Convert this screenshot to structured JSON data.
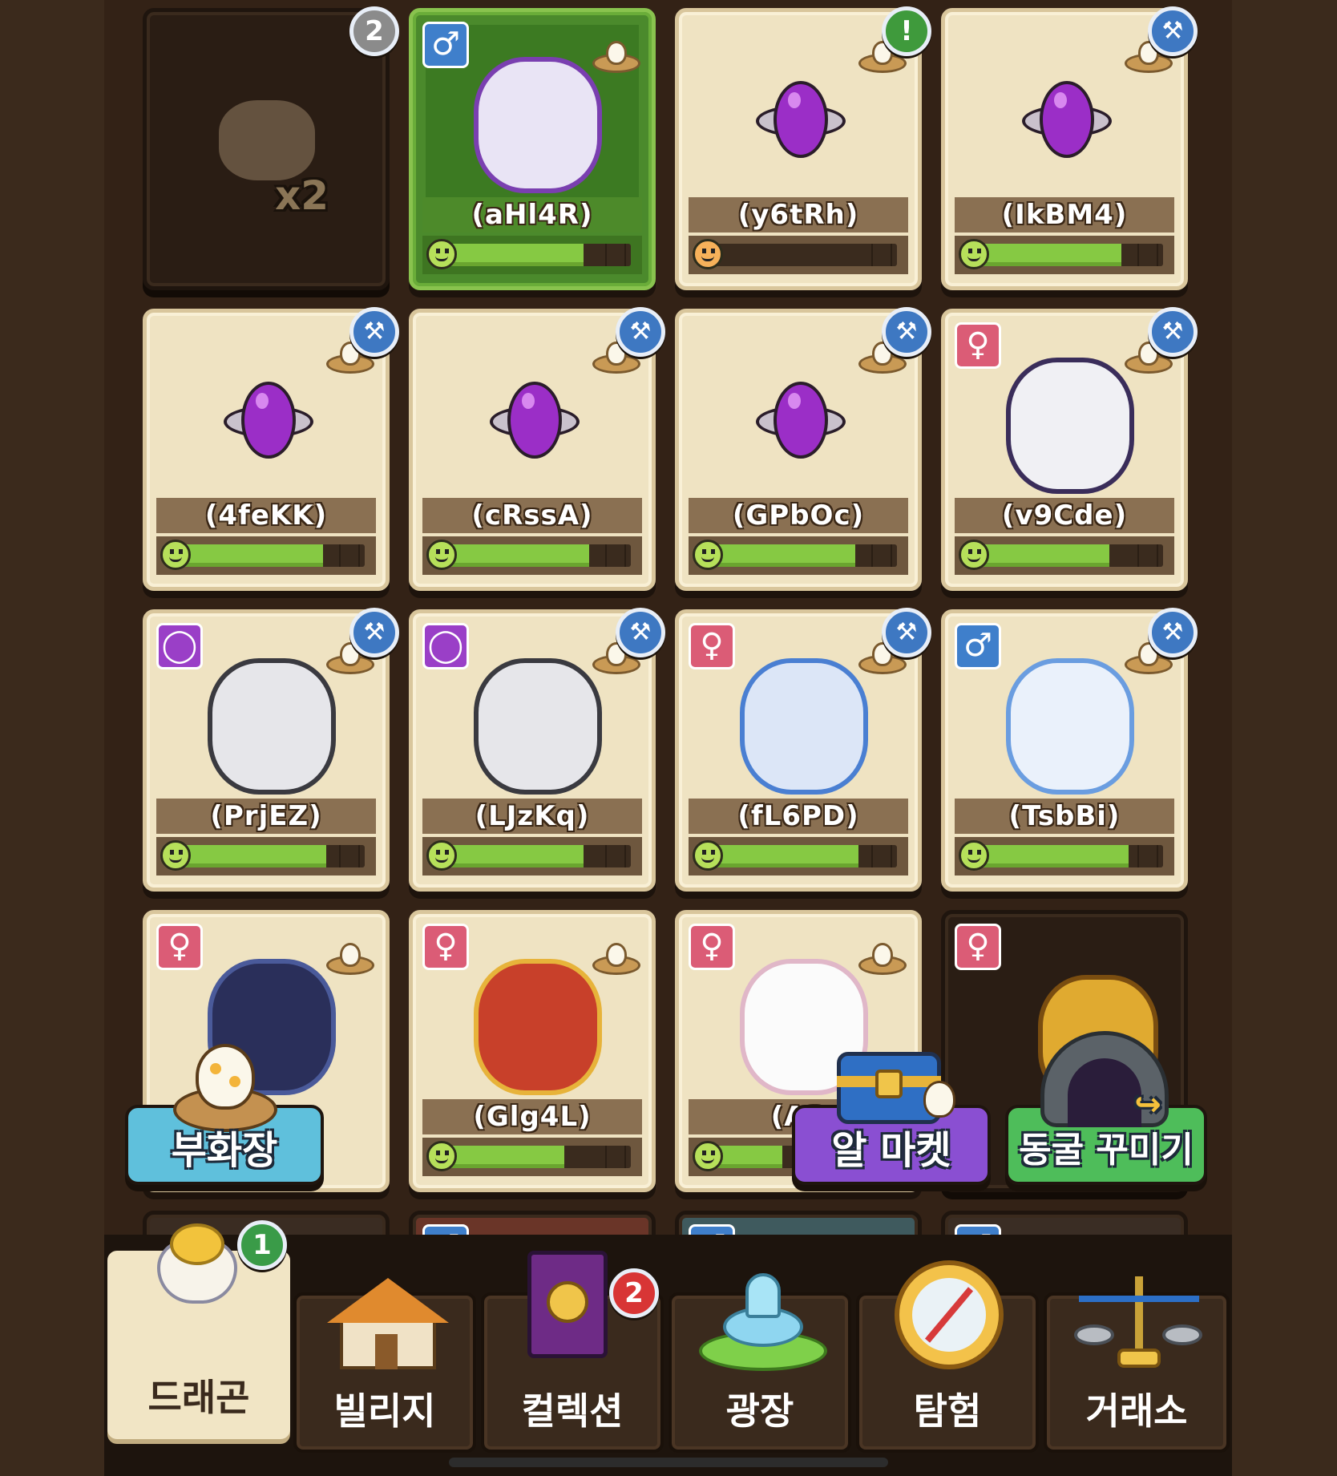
{
  "cards": [
    {
      "name": "",
      "badge": "2",
      "badge_type": "count",
      "dark": true,
      "multiplier": "x2"
    },
    {
      "name": "(aHl4R)",
      "gender": "♂",
      "gender_type": "m",
      "badge_type": "none",
      "selected": true,
      "health": 0.75,
      "nest": true
    },
    {
      "name": "(y6tRh)",
      "badge": "!",
      "badge_type": "alert",
      "health": 0.05,
      "health_color": "orange",
      "nest": true,
      "sprite": "egg"
    },
    {
      "name": "(IkBM4)",
      "badge": "⚒",
      "badge_type": "tool",
      "health": 0.78,
      "nest": true,
      "sprite": "egg"
    },
    {
      "name": "(4feKK)",
      "badge": "⚒",
      "badge_type": "tool",
      "health": 0.78,
      "nest": true,
      "sprite": "egg"
    },
    {
      "name": "(cRssA)",
      "badge": "⚒",
      "badge_type": "tool",
      "health": 0.78,
      "nest": true,
      "sprite": "egg"
    },
    {
      "name": "(GPbOc)",
      "badge": "⚒",
      "badge_type": "tool",
      "health": 0.78,
      "nest": true,
      "sprite": "egg"
    },
    {
      "name": "(v9Cde)",
      "gender": "♀",
      "gender_type": "f",
      "badge": "⚒",
      "badge_type": "tool",
      "health": 0.72,
      "nest": true
    },
    {
      "name": "(PrjEZ)",
      "gender": "◯",
      "gender_type": "n",
      "badge": "⚒",
      "badge_type": "tool",
      "health": 0.8,
      "nest": true
    },
    {
      "name": "(LJzKq)",
      "gender": "◯",
      "gender_type": "n",
      "badge": "⚒",
      "badge_type": "tool",
      "health": 0.75,
      "nest": true
    },
    {
      "name": "(fL6PD)",
      "gender": "♀",
      "gender_type": "f",
      "badge": "⚒",
      "badge_type": "tool",
      "health": 0.8,
      "nest": true
    },
    {
      "name": "(TsbBi)",
      "gender": "♂",
      "gender_type": "m",
      "badge": "⚒",
      "badge_type": "tool",
      "health": 0.82,
      "nest": true
    },
    {
      "name": "",
      "gender": "♀",
      "gender_type": "f",
      "badge_type": "none",
      "health": 0.0,
      "nest": true
    },
    {
      "name": "(Glg4L)",
      "gender": "♀",
      "gender_type": "f",
      "badge_type": "none",
      "health": 0.65,
      "nest": true
    },
    {
      "name": "(A3",
      "gender": "♀",
      "gender_type": "f",
      "badge_type": "none",
      "health": 0.4,
      "nest": true
    },
    {
      "name": "",
      "gender": "♀",
      "gender_type": "f",
      "badge_type": "none",
      "dark": true
    }
  ],
  "row5_genders": [
    "",
    "♂",
    "♂",
    "♂"
  ],
  "actions": {
    "hatchery": "부화장",
    "egg_market": "알 마켓",
    "cave_decor": "동굴 꾸미기"
  },
  "nav": {
    "tabs": [
      {
        "label": "드래곤",
        "badge": "1"
      },
      {
        "label": "빌리지"
      },
      {
        "label": "컬렉션",
        "badge": "2"
      },
      {
        "label": "광장"
      },
      {
        "label": "탐험"
      },
      {
        "label": "거래소"
      }
    ]
  },
  "colors": {
    "accent_green": "#86c943",
    "tool_blue": "#3e78c2",
    "female_pink": "#db5c76",
    "male_blue": "#3f7fcb",
    "neutral_purple": "#9a3fc7"
  }
}
